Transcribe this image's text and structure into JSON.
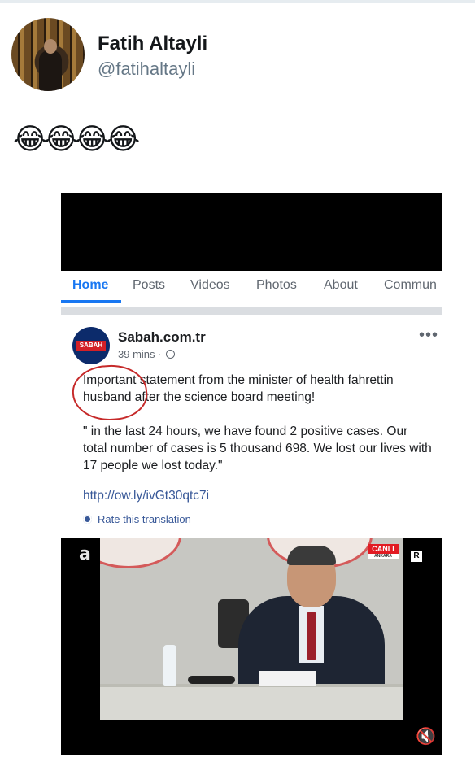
{
  "tweet": {
    "author_name": "Fatih Altayli",
    "author_handle": "@fatihaltayli",
    "text": "😂😂😂😂"
  },
  "facebook": {
    "tabs": [
      {
        "label": "Home"
      },
      {
        "label": "Posts"
      },
      {
        "label": "Videos"
      },
      {
        "label": "Photos"
      },
      {
        "label": "About"
      },
      {
        "label": "Commun"
      }
    ],
    "post": {
      "source": "Sabah.com.tr",
      "logo_text": "SABAH",
      "time": "39 mins · ",
      "body": "Important statement from the minister of health fahrettin husband after the science board meeting!",
      "quote": "\" in the last 24 hours, we have found 2 positive cases. Our total number of cases is 5 thousand 698. We lost our lives with 17 people we lost today.\"",
      "link": "http://ow.ly/ivGt30qtc7i",
      "translate_label": "Rate this translation"
    },
    "video": {
      "channel_logo": "a",
      "live_label": "CANLI",
      "live_location": "ANKARA",
      "corner_badge": "R",
      "mute_icon": "🔇"
    }
  },
  "colors": {
    "facebook_blue": "#1877f2",
    "link_blue": "#385898",
    "circle_red": "#c62a2a",
    "twitter_gray": "#657786"
  }
}
